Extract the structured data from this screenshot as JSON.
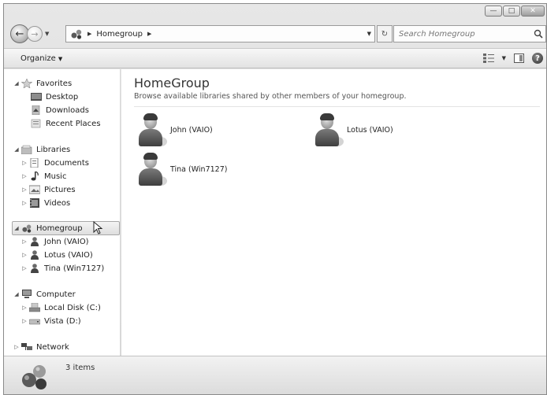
{
  "window": {
    "caption_buttons": [
      "minimize",
      "maximize",
      "close"
    ]
  },
  "address": {
    "crumb": "Homegroup",
    "search_placeholder": "Search Homegroup"
  },
  "toolbar": {
    "organize_label": "Organize"
  },
  "nav": {
    "favorites": {
      "label": "Favorites",
      "items": [
        "Desktop",
        "Downloads",
        "Recent Places"
      ]
    },
    "libraries": {
      "label": "Libraries",
      "items": [
        "Documents",
        "Music",
        "Pictures",
        "Videos"
      ]
    },
    "homegroup": {
      "label": "Homegroup",
      "items": [
        "John (VAIO)",
        "Lotus (VAIO)",
        "Tina (Win7127)"
      ]
    },
    "computer": {
      "label": "Computer",
      "items": [
        "Local Disk (C:)",
        "Vista (D:)"
      ]
    },
    "network": {
      "label": "Network"
    }
  },
  "content": {
    "title": "HomeGroup",
    "subtitle": "Browse available libraries shared by other members of your homegroup.",
    "members": [
      "John (VAIO)",
      "Lotus (VAIO)",
      "Tina (Win7127)"
    ]
  },
  "details": {
    "count": "3 items"
  },
  "icons": {
    "back": "back-arrow-icon",
    "forward": "forward-arrow-icon",
    "search": "search-icon",
    "help": "help-icon",
    "homegroup": "homegroup-icon",
    "person": "person-icon"
  }
}
